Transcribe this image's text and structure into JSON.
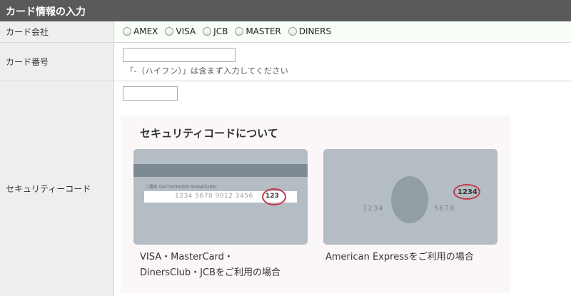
{
  "header": {
    "title": "カード情報の入力"
  },
  "company": {
    "label": "カード会社",
    "options": [
      "AMEX",
      "VISA",
      "JCB",
      "MASTER",
      "DINERS"
    ]
  },
  "card_number": {
    "label": "カード番号",
    "value": "",
    "hint": "「-（ハイフン）」は含まず入力してください"
  },
  "security": {
    "label": "セキュリティーコード",
    "value": "",
    "info_title": "セキュリティコードについて",
    "back_card": {
      "signature_caption": "ご署名 (AUTHORIZED SIGNATURE)",
      "number": "1234 5678 9012 3456",
      "code": "123",
      "caption_line1": "VISA・MasterCard・",
      "caption_line2": "DinersClub・JCBをご利用の場合"
    },
    "amex_card": {
      "code": "1234",
      "number_left": "1234",
      "number_right": "5678",
      "caption": "American Expressをご利用の場合"
    }
  },
  "colors": {
    "header_bg": "#5a5a5a",
    "highlight": "#c8354f",
    "card": "#b3bdc3"
  }
}
